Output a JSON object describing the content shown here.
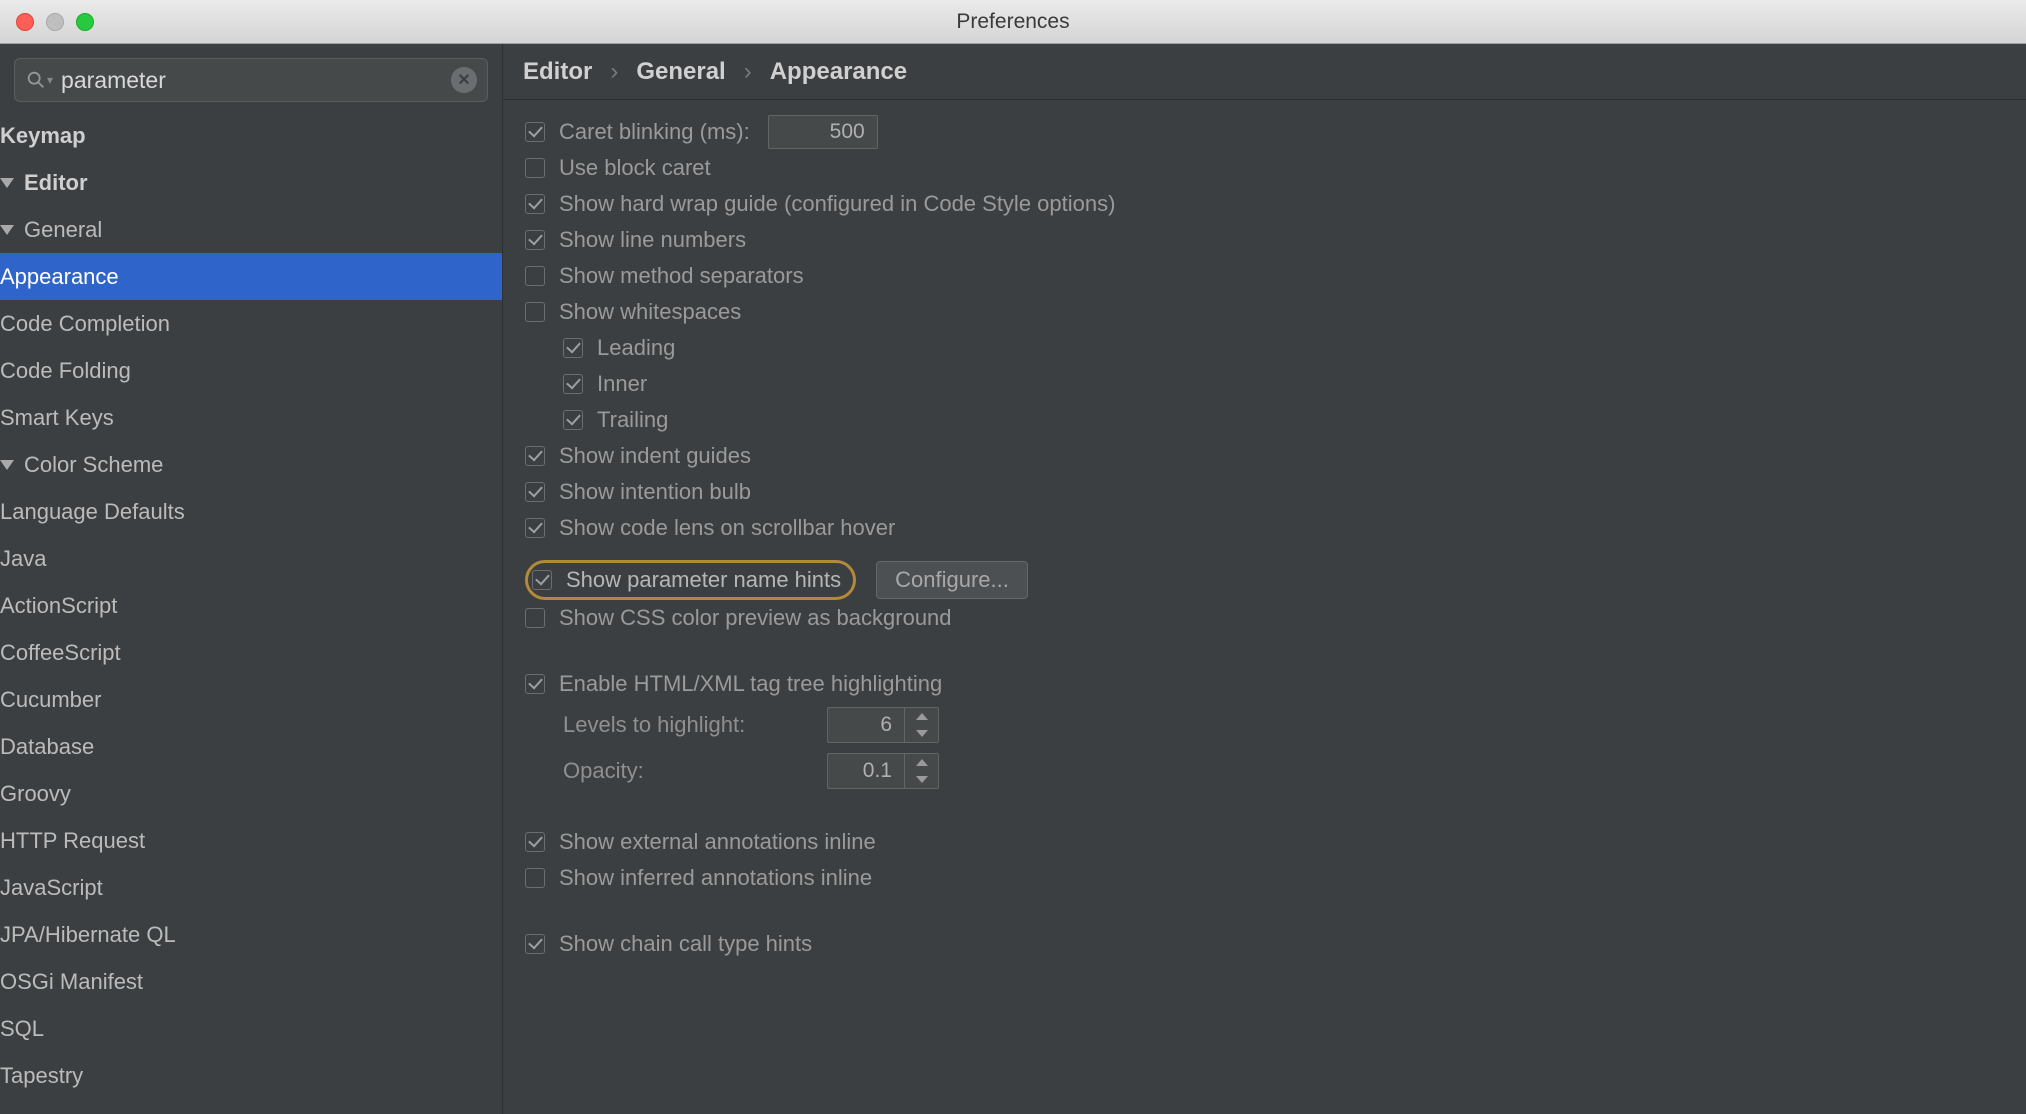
{
  "window": {
    "title": "Preferences"
  },
  "search": {
    "value": "parameter"
  },
  "tree": {
    "keymap": "Keymap",
    "editor": "Editor",
    "general": "General",
    "appearance": "Appearance",
    "code_completion": "Code Completion",
    "code_folding": "Code Folding",
    "smart_keys": "Smart Keys",
    "color_scheme": "Color Scheme",
    "cs_items": [
      "Language Defaults",
      "Java",
      "ActionScript",
      "CoffeeScript",
      "Cucumber",
      "Database",
      "Groovy",
      "HTTP Request",
      "JavaScript",
      "JPA/Hibernate QL",
      "OSGi Manifest",
      "SQL",
      "Tapestry"
    ]
  },
  "breadcrumb": {
    "a": "Editor",
    "b": "General",
    "c": "Appearance"
  },
  "panel": {
    "caret_blinking": "Caret blinking (ms):",
    "caret_blinking_val": "500",
    "use_block_caret": "Use block caret",
    "hard_wrap": "Show hard wrap guide (configured in Code Style options)",
    "line_numbers": "Show line numbers",
    "method_sep": "Show method separators",
    "whitespaces": "Show whitespaces",
    "ws_leading": "Leading",
    "ws_inner": "Inner",
    "ws_trailing": "Trailing",
    "indent_guides": "Show indent guides",
    "intention_bulb": "Show intention bulb",
    "code_lens": "Show code lens on scrollbar hover",
    "param_hints": "Show parameter name hints",
    "configure_btn": "Configure...",
    "css_color": "Show CSS color preview as background",
    "tag_tree": "Enable HTML/XML tag tree highlighting",
    "levels_label": "Levels to highlight:",
    "levels_val": "6",
    "opacity_label": "Opacity:",
    "opacity_val": "0.1",
    "ext_annot": "Show external annotations inline",
    "inf_annot": "Show inferred annotations inline",
    "chain_hints": "Show chain call type hints"
  }
}
